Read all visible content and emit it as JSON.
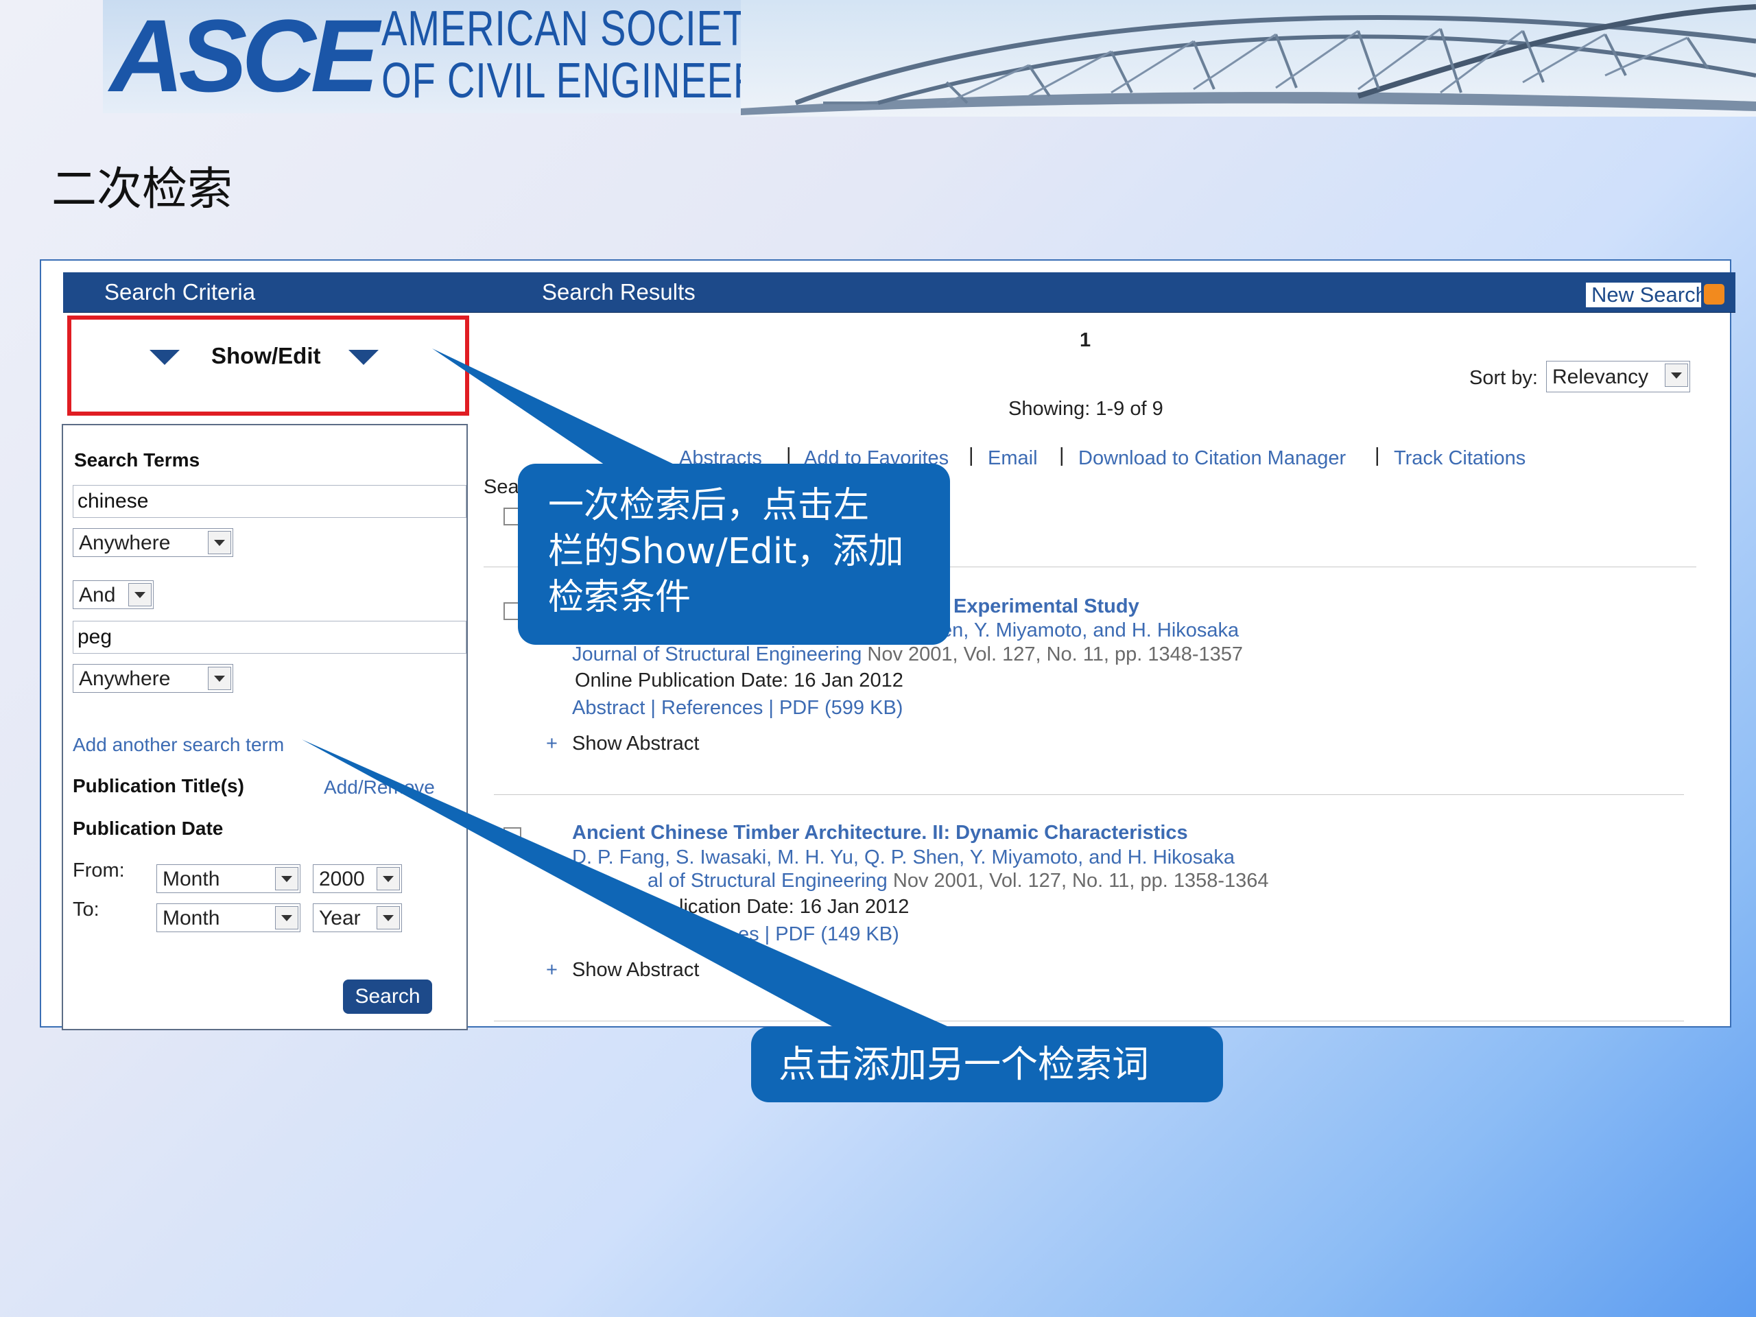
{
  "banner": {
    "logo": "ASCE",
    "society_line1": "AMERICAN SOCIETY",
    "society_line2": "OF CIVIL ENGINEERS"
  },
  "slide_title": "二次检索",
  "left": {
    "header": "Search Criteria",
    "show_edit": "Show/Edit",
    "search_terms_label": "Search Terms",
    "term1": "chinese",
    "term1_scope": "Anywhere",
    "operator": "And",
    "term2": "peg",
    "term2_scope": "Anywhere",
    "add_term_link": "Add another search term",
    "pub_titles_label": "Publication Title(s)",
    "add_remove_link": "Add/Remove",
    "pub_date_label": "Publication Date",
    "from_label": "From:",
    "to_label": "To:",
    "from_month": "Month",
    "from_year": "2000",
    "to_month": "Month",
    "to_year": "Year",
    "search_button": "Search"
  },
  "right": {
    "header": "Search Results",
    "new_search": "New Search",
    "page": "1",
    "sort_label": "Sort by:",
    "sort_value": "Relevancy",
    "showing": "Showing: 1-9 of 9",
    "actions": [
      "Abstracts",
      "Add to Favorites",
      "Email",
      "Download to Citation Manager",
      "Track Citations"
    ],
    "partial_label": "Sea",
    "results": [
      {
        "title": "Experimental Study",
        "authors": "en, Y. Miyamoto, and H. Hikosaka",
        "journal": "Journal of Structural Engineering",
        "citation": " Nov 2001, Vol. 127, No. 11, pp. 1348-1357",
        "online_date": "Online Publication Date: 16 Jan 2012",
        "links": "Abstract | References | PDF (599 KB)",
        "show_abstract": "Show Abstract"
      },
      {
        "title": "Ancient Chinese Timber Architecture. II: Dynamic Characteristics",
        "authors": "D. P. Fang, S. Iwasaki, M. H. Yu, Q. P. Shen, Y. Miyamoto, and H. Hikosaka",
        "journal": "al of Structural Engineering",
        "citation": " Nov 2001, Vol. 127, No. 11, pp. 1358-1364",
        "online_date": "lication Date: 16 Jan 2012",
        "links": "es | PDF (149 KB)",
        "show_abstract": "Show Abstract"
      }
    ]
  },
  "callouts": {
    "first": [
      "一次检索后，点击左",
      "栏的Show/Edit，添加",
      "检索条件"
    ],
    "second": "点击添加另一个检索词"
  },
  "colors": {
    "header_blue": "#1d4a8a",
    "link_blue": "#3c6bb3",
    "callout_blue": "#0f66b6",
    "highlight_red": "#e01d23"
  }
}
